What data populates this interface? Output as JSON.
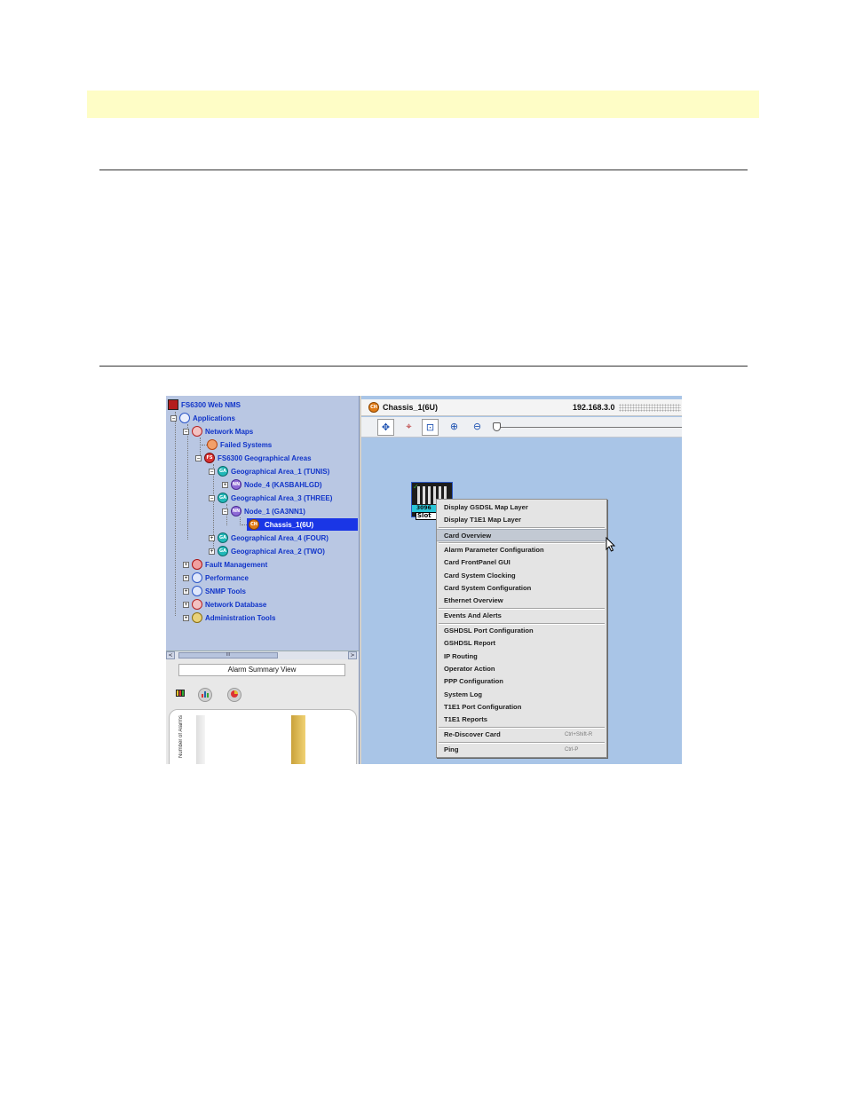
{
  "tree": {
    "root": "FS6300 Web NMS",
    "applications": "Applications",
    "network_maps": "Network Maps",
    "failed_systems": "Failed Systems",
    "geo_areas": "FS6300 Geographical Areas",
    "geo1": "Geographical Area_1 (TUNIS)",
    "node4": "Node_4 (KASBAHLGD)",
    "geo3": "Geographical Area_3 (THREE)",
    "node1": "Node_1 (GA3NN1)",
    "chassis": "Chassis_1(6U)",
    "geo4": "Geographical Area_4 (FOUR)",
    "geo2": "Geographical Area_2 (TWO)",
    "fault": "Fault Management",
    "performance": "Performance",
    "snmp": "SNMP Tools",
    "netdb": "Network Database",
    "admin": "Administration Tools",
    "icon_labels": {
      "ga": "GA",
      "nn": "NN",
      "ch": "CH",
      "fs": "FS"
    }
  },
  "scrollbar": {
    "left": "<",
    "right": ">",
    "thumb": "III"
  },
  "alarm": {
    "title": "Alarm Summary View",
    "ylabel": "Number of Alarms"
  },
  "map": {
    "title": "Chassis_1(6U)",
    "ip": "192.168.3.0",
    "card_number": "3096",
    "slot_label": "Slot"
  },
  "menu": {
    "items": [
      "Display GSDSL Map Layer",
      "Display T1E1 Map Layer",
      "Card Overview",
      "Alarm Parameter Configuration",
      "Card FrontPanel GUI",
      "Card System Clocking",
      "Card System Configuration",
      "Ethernet Overview",
      "Events And Alerts",
      "GSHDSL Port Configuration",
      "GSHDSL Report",
      "IP Routing",
      "Operator Action",
      "PPP Configuration",
      "System Log",
      "T1E1 Port Configuration",
      "T1E1 Reports",
      "Re-Discover Card",
      "Ping"
    ],
    "rediscover_shortcut": "Ctrl+Shift-R",
    "ping_shortcut": "Ctrl-P"
  },
  "colors": {
    "note_bar": "#fefdc6",
    "tree_bg": "#b9c7e3",
    "tree_link": "#1034c9",
    "tree_selected": "#1a36e6",
    "map_bg": "#a9c5e7",
    "menu_bg": "#e4e4e4",
    "menu_highlight": "#c2c9d3"
  },
  "icons": {
    "expand": "plus-minus-box",
    "root": "fs6300-logo-icon",
    "apps": "applications-icon",
    "maps": "network-maps-icon",
    "failed": "failed-systems-icon",
    "fault": "fault-management-icon",
    "perf": "performance-icon",
    "snmp": "snmp-tools-icon",
    "db": "network-database-icon",
    "admin": "administration-tools-icon"
  }
}
